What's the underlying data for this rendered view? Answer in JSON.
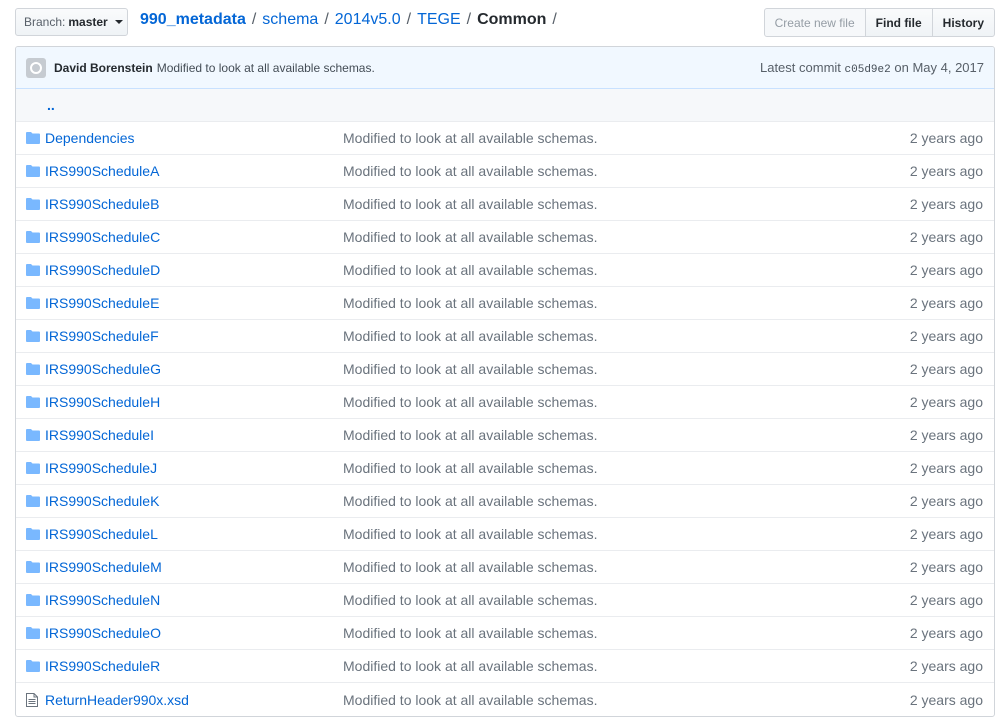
{
  "branch": {
    "label": "Branch:",
    "value": "master"
  },
  "breadcrumb": {
    "root": "990_metadata",
    "parts": [
      "schema",
      "2014v5.0",
      "TEGE"
    ],
    "current": "Common",
    "separator": "/"
  },
  "actions": {
    "create": "Create new file",
    "find": "Find file",
    "history": "History"
  },
  "commit": {
    "author": "David Borenstein",
    "message": "Modified to look at all available schemas.",
    "latest_label": "Latest commit",
    "sha": "c05d9e2",
    "date": "on May 4, 2017"
  },
  "up_link": "..",
  "files": [
    {
      "name": "Dependencies",
      "type": "dir",
      "message": "Modified to look at all available schemas.",
      "age": "2 years ago"
    },
    {
      "name": "IRS990ScheduleA",
      "type": "dir",
      "message": "Modified to look at all available schemas.",
      "age": "2 years ago"
    },
    {
      "name": "IRS990ScheduleB",
      "type": "dir",
      "message": "Modified to look at all available schemas.",
      "age": "2 years ago"
    },
    {
      "name": "IRS990ScheduleC",
      "type": "dir",
      "message": "Modified to look at all available schemas.",
      "age": "2 years ago"
    },
    {
      "name": "IRS990ScheduleD",
      "type": "dir",
      "message": "Modified to look at all available schemas.",
      "age": "2 years ago"
    },
    {
      "name": "IRS990ScheduleE",
      "type": "dir",
      "message": "Modified to look at all available schemas.",
      "age": "2 years ago"
    },
    {
      "name": "IRS990ScheduleF",
      "type": "dir",
      "message": "Modified to look at all available schemas.",
      "age": "2 years ago"
    },
    {
      "name": "IRS990ScheduleG",
      "type": "dir",
      "message": "Modified to look at all available schemas.",
      "age": "2 years ago"
    },
    {
      "name": "IRS990ScheduleH",
      "type": "dir",
      "message": "Modified to look at all available schemas.",
      "age": "2 years ago"
    },
    {
      "name": "IRS990ScheduleI",
      "type": "dir",
      "message": "Modified to look at all available schemas.",
      "age": "2 years ago"
    },
    {
      "name": "IRS990ScheduleJ",
      "type": "dir",
      "message": "Modified to look at all available schemas.",
      "age": "2 years ago"
    },
    {
      "name": "IRS990ScheduleK",
      "type": "dir",
      "message": "Modified to look at all available schemas.",
      "age": "2 years ago"
    },
    {
      "name": "IRS990ScheduleL",
      "type": "dir",
      "message": "Modified to look at all available schemas.",
      "age": "2 years ago"
    },
    {
      "name": "IRS990ScheduleM",
      "type": "dir",
      "message": "Modified to look at all available schemas.",
      "age": "2 years ago"
    },
    {
      "name": "IRS990ScheduleN",
      "type": "dir",
      "message": "Modified to look at all available schemas.",
      "age": "2 years ago"
    },
    {
      "name": "IRS990ScheduleO",
      "type": "dir",
      "message": "Modified to look at all available schemas.",
      "age": "2 years ago"
    },
    {
      "name": "IRS990ScheduleR",
      "type": "dir",
      "message": "Modified to look at all available schemas.",
      "age": "2 years ago"
    },
    {
      "name": "ReturnHeader990x.xsd",
      "type": "file",
      "message": "Modified to look at all available schemas.",
      "age": "2 years ago"
    }
  ],
  "colors": {
    "link": "#0366d6",
    "folder": "#79b8ff",
    "commit_bg": "#f1f8ff"
  }
}
